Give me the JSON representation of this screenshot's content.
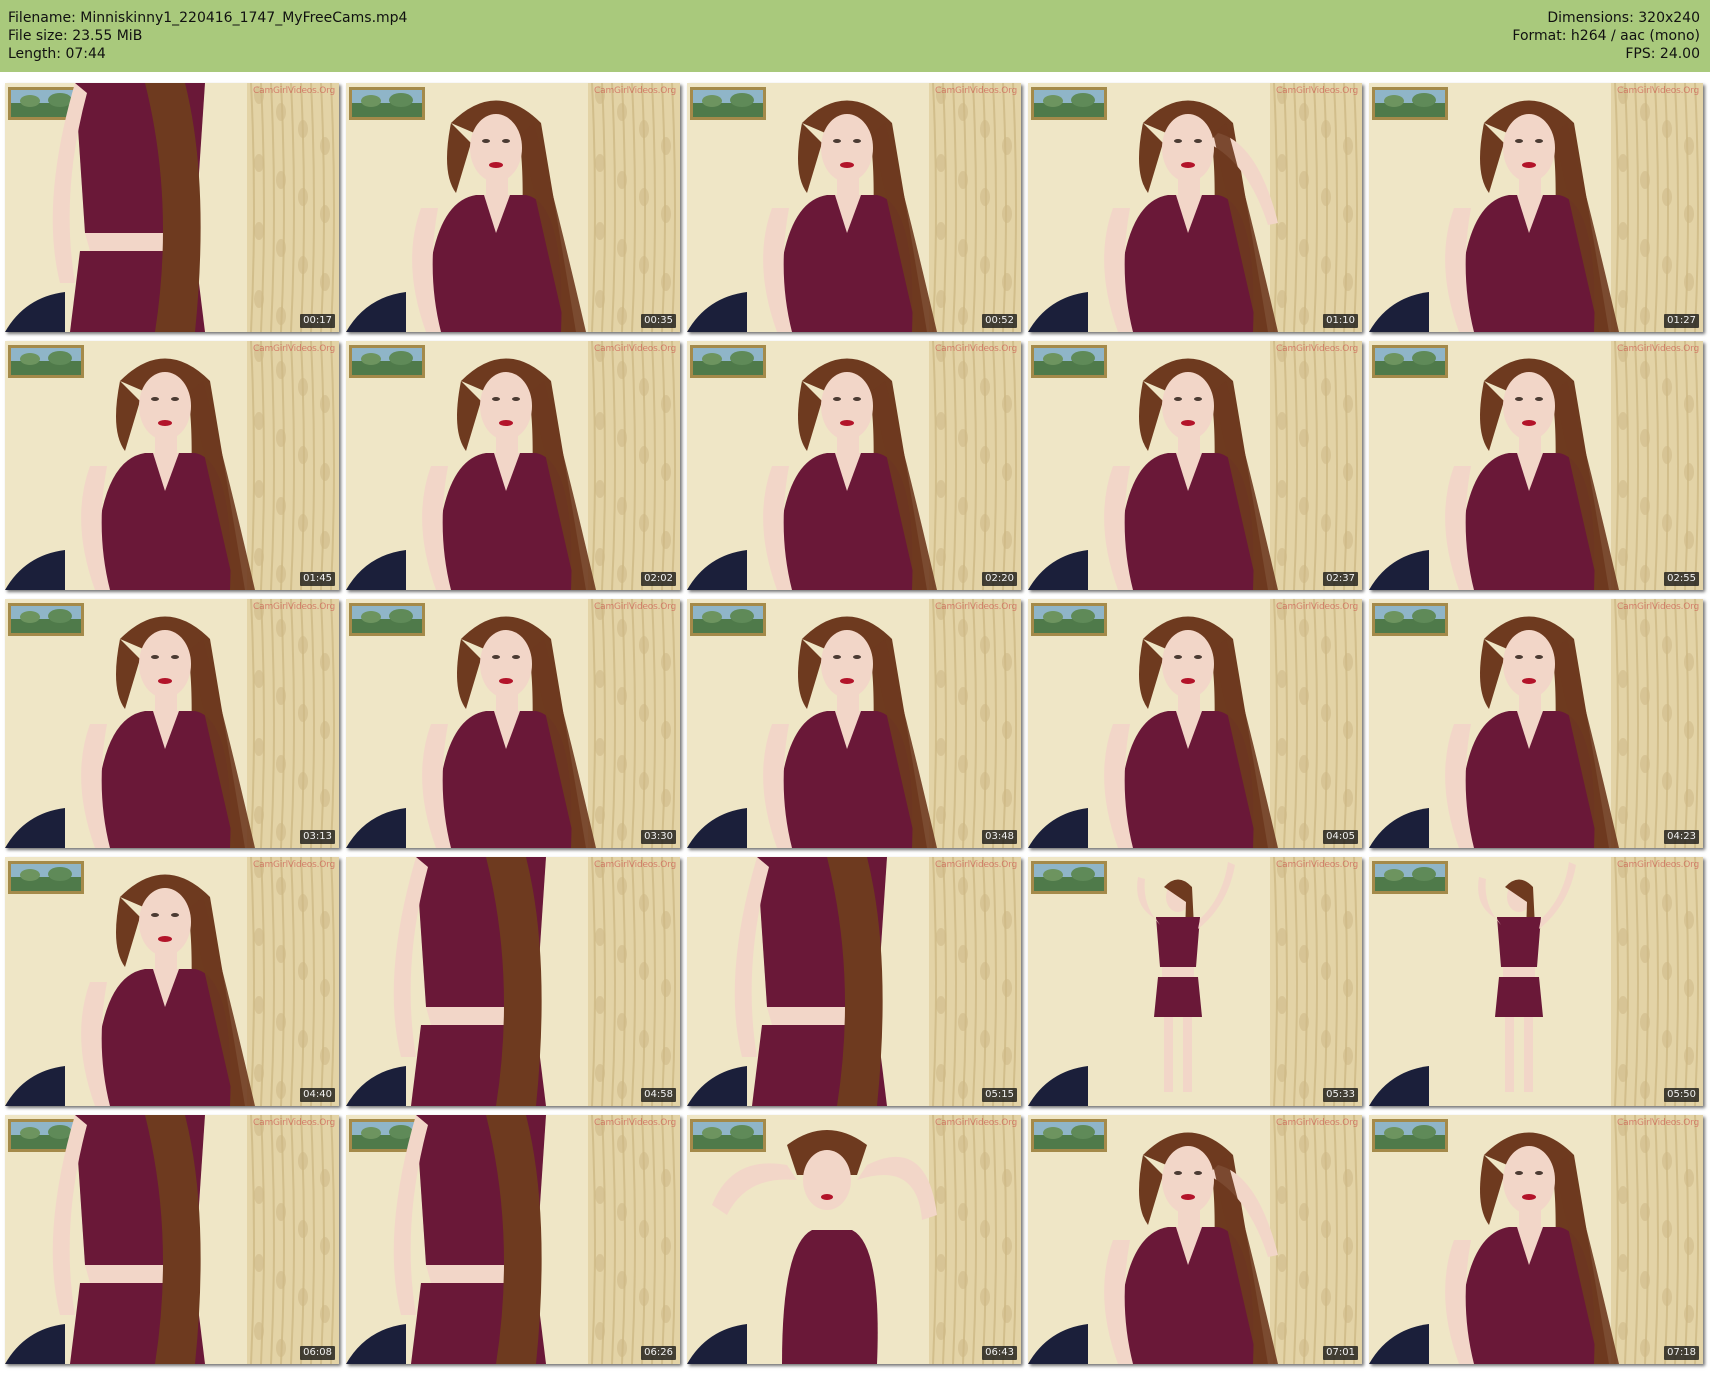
{
  "header": {
    "filename": "Filename: Minniskinny1_220416_1747_MyFreeCams.mp4",
    "filesize": "File size: 23.55 MiB",
    "length": "Length: 07:44",
    "dimensions": "Dimensions: 320x240",
    "format": "Format: h264 / aac (mono)",
    "fps": "FPS: 24.00"
  },
  "colors": {
    "header_bg": "#a9c97c",
    "wall": "#efe6c6",
    "curtain": "#e3d3a6",
    "top": "#6a1838",
    "hair": "#6e3a1f",
    "skin": "#f2d6c8"
  },
  "watermark": "CamGirlVideos.Org",
  "frames": [
    {
      "time": "00:17",
      "pose": "close-body",
      "show_painting": true
    },
    {
      "time": "00:35",
      "pose": "tilt",
      "show_painting": true
    },
    {
      "time": "00:52",
      "pose": "portrait",
      "show_painting": true
    },
    {
      "time": "01:10",
      "pose": "hand-head",
      "show_painting": true
    },
    {
      "time": "01:27",
      "pose": "portrait",
      "show_painting": true
    },
    {
      "time": "01:45",
      "pose": "portrait",
      "show_painting": true
    },
    {
      "time": "02:02",
      "pose": "portrait",
      "show_painting": true
    },
    {
      "time": "02:20",
      "pose": "portrait",
      "show_painting": true
    },
    {
      "time": "02:37",
      "pose": "portrait",
      "show_painting": true
    },
    {
      "time": "02:55",
      "pose": "portrait",
      "show_painting": true
    },
    {
      "time": "03:13",
      "pose": "portrait",
      "show_painting": true
    },
    {
      "time": "03:30",
      "pose": "portrait",
      "show_painting": true
    },
    {
      "time": "03:48",
      "pose": "portrait",
      "show_painting": true
    },
    {
      "time": "04:05",
      "pose": "portrait",
      "show_painting": true
    },
    {
      "time": "04:23",
      "pose": "portrait",
      "show_painting": true
    },
    {
      "time": "04:40",
      "pose": "portrait",
      "show_painting": true
    },
    {
      "time": "04:58",
      "pose": "close-body",
      "show_painting": false
    },
    {
      "time": "05:15",
      "pose": "close-body",
      "show_painting": false
    },
    {
      "time": "05:33",
      "pose": "full-body",
      "show_painting": true
    },
    {
      "time": "05:50",
      "pose": "full-body",
      "show_painting": true
    },
    {
      "time": "06:08",
      "pose": "close-body",
      "show_painting": true
    },
    {
      "time": "06:26",
      "pose": "close-body",
      "show_painting": true
    },
    {
      "time": "06:43",
      "pose": "arms-up",
      "show_painting": true
    },
    {
      "time": "07:01",
      "pose": "hand-head",
      "show_painting": true
    },
    {
      "time": "07:18",
      "pose": "portrait",
      "show_painting": true
    }
  ]
}
